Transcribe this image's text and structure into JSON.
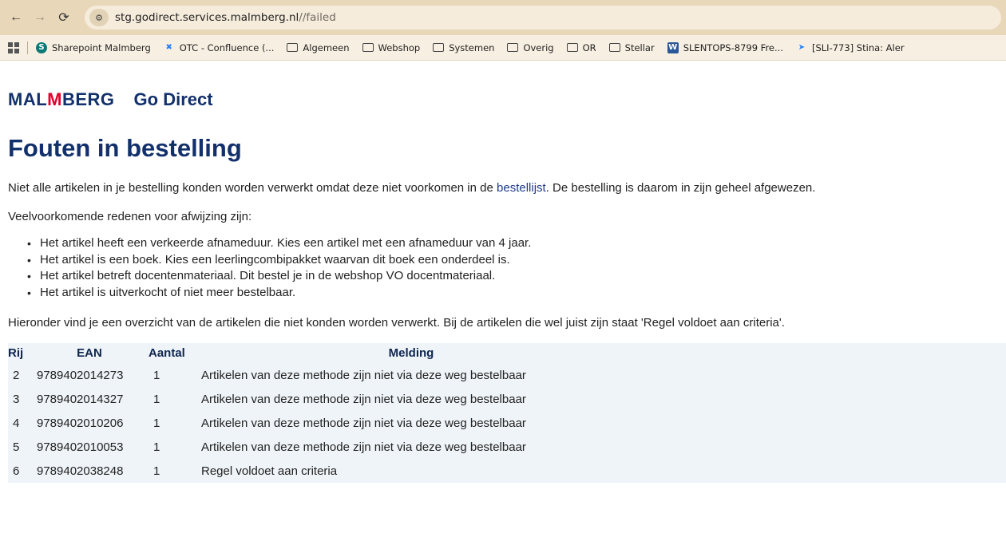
{
  "browser": {
    "url_host": "stg.godirect.services.malmberg.nl",
    "url_path": "//failed",
    "bookmarks": [
      {
        "label": "Sharepoint Malmberg",
        "icon": "sharepoint-icon"
      },
      {
        "label": "OTC - Confluence (...",
        "icon": "confluence-icon"
      },
      {
        "label": "Algemeen",
        "icon": "folder-icon"
      },
      {
        "label": "Webshop",
        "icon": "folder-icon"
      },
      {
        "label": "Systemen",
        "icon": "folder-icon"
      },
      {
        "label": "Overig",
        "icon": "folder-icon"
      },
      {
        "label": "OR",
        "icon": "folder-icon"
      },
      {
        "label": "Stellar",
        "icon": "folder-icon"
      },
      {
        "label": "SLENTOPS-8799 Fre...",
        "icon": "word-icon"
      },
      {
        "label": "[SLI-773] Stina: Aler",
        "icon": "jira-icon"
      }
    ]
  },
  "brand": {
    "logo_pre": "MAL",
    "logo_m": "M",
    "logo_post": "BERG",
    "sub": "Go Direct"
  },
  "page": {
    "title": "Fouten in bestelling",
    "intro_pre": "Niet alle artikelen in je bestelling konden worden verwerkt omdat deze niet voorkomen in de ",
    "intro_link": "bestellijst",
    "intro_post": ". De bestelling is daarom in zijn geheel afgewezen.",
    "reasons_label": "Veelvoorkomende redenen voor afwijzing zijn:",
    "reasons": [
      "Het artikel heeft een verkeerde afnameduur. Kies een artikel met een afnameduur van 4 jaar.",
      "Het artikel is een boek. Kies een leerlingcombipakket waarvan dit boek een onderdeel is.",
      "Het artikel betreft docentenmateriaal. Dit bestel je in de webshop VO docentmateriaal.",
      "Het artikel is uitverkocht of niet meer bestelbaar."
    ],
    "overview": "Hieronder vind je een overzicht van de artikelen die niet konden worden verwerkt. Bij de artikelen die wel juist zijn staat 'Regel voldoet aan criteria'."
  },
  "table": {
    "headers": {
      "rij": "Rij",
      "ean": "EAN",
      "aantal": "Aantal",
      "melding": "Melding"
    },
    "rows": [
      {
        "rij": "2",
        "ean": "9789402014273",
        "aantal": "1",
        "melding": "Artikelen van deze methode zijn niet via deze weg bestelbaar"
      },
      {
        "rij": "3",
        "ean": "9789402014327",
        "aantal": "1",
        "melding": "Artikelen van deze methode zijn niet via deze weg bestelbaar"
      },
      {
        "rij": "4",
        "ean": "9789402010206",
        "aantal": "1",
        "melding": "Artikelen van deze methode zijn niet via deze weg bestelbaar"
      },
      {
        "rij": "5",
        "ean": "9789402010053",
        "aantal": "1",
        "melding": "Artikelen van deze methode zijn niet via deze weg bestelbaar"
      },
      {
        "rij": "6",
        "ean": "9789402038248",
        "aantal": "1",
        "melding": "Regel voldoet aan criteria"
      }
    ]
  }
}
